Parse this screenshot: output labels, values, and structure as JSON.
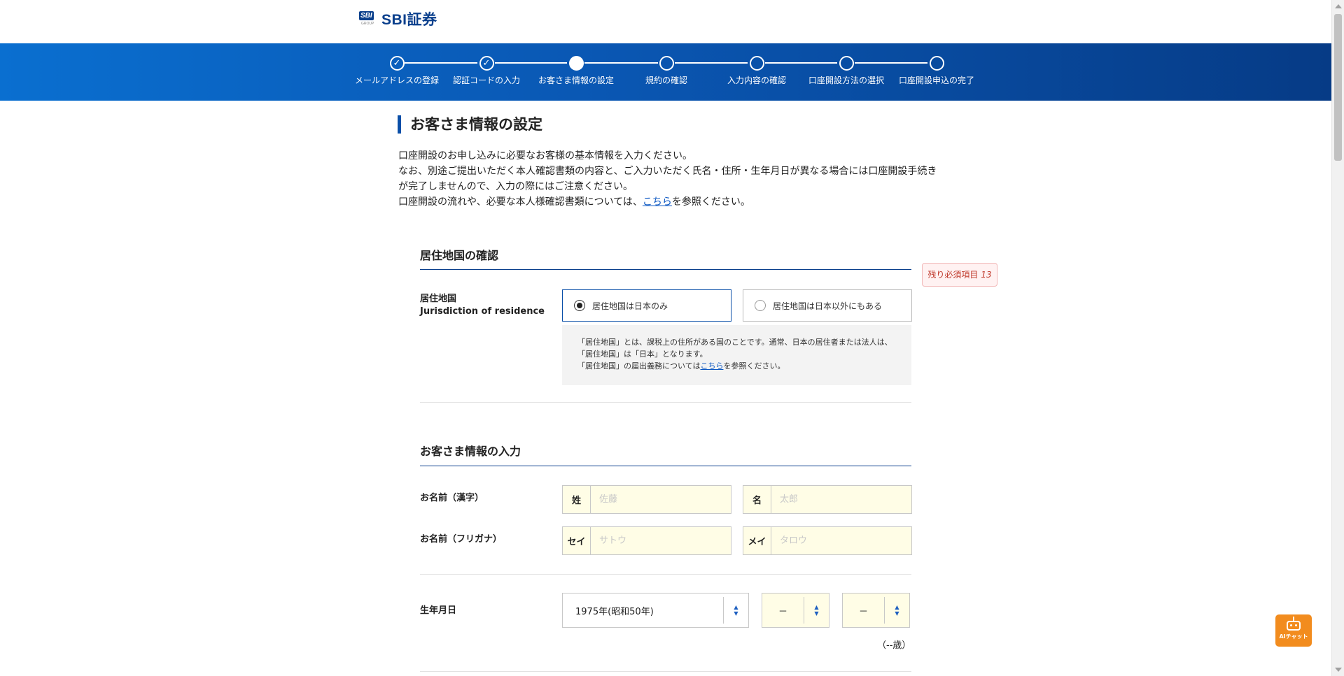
{
  "header": {
    "logo_badge": "SBI",
    "logo_group": "GROUP",
    "logo_text": "SBI証券"
  },
  "steps": [
    {
      "label": "メールアドレスの登録",
      "state": "done"
    },
    {
      "label": "認証コードの入力",
      "state": "done"
    },
    {
      "label": "お客さま情報の設定",
      "state": "current"
    },
    {
      "label": "規約の確認",
      "state": "todo"
    },
    {
      "label": "入力内容の確認",
      "state": "todo"
    },
    {
      "label": "口座開設方法の選択",
      "state": "todo"
    },
    {
      "label": "口座開設申込の完了",
      "state": "todo"
    }
  ],
  "page": {
    "title": "お客さま情報の設定",
    "intro_line1": "口座開設のお申し込みに必要なお客様の基本情報を入力ください。",
    "intro_line2": "なお、別途ご提出いただく本人確認書類の内容と、ご入力いただく氏名・住所・生年月日が異なる場合には口座開設手続きが完了しませんので、入力の際にはご注意ください。",
    "intro_line3_pre": "口座開設の流れや、必要な本人様確認書類については、",
    "intro_line3_link": "こちら",
    "intro_line3_post": "を参照ください。"
  },
  "residence": {
    "section_title": "居住地国の確認",
    "remaining_label": "残り必須項目",
    "remaining_count": "13",
    "label_ja": "居住地国",
    "label_en": "Jurisdiction of residence",
    "option_japan": "居住地国は日本のみ",
    "option_other": "居住地国は日本以外にもある",
    "note_line1": "「居住地国」とは、課税上の住所がある国のことです。通常、日本の居住者または法人は、",
    "note_line2": "「居住地国」は「日本」となります。",
    "note_line3_pre": "「居住地国」の届出義務については",
    "note_line3_link": "こちら",
    "note_line3_post": "を参照ください。"
  },
  "customer": {
    "section_title": "お客さま情報の入力",
    "name_kanji_label": "お名前（漢字）",
    "sei_prefix": "姓",
    "sei_placeholder": "佐藤",
    "mei_prefix": "名",
    "mei_placeholder": "太郎",
    "name_kana_label": "お名前（フリガナ）",
    "sei_kana_prefix": "セイ",
    "sei_kana_placeholder": "サトウ",
    "mei_kana_prefix": "メイ",
    "mei_kana_placeholder": "タロウ",
    "birth_label": "生年月日",
    "birth_year": "1975年(昭和50年)",
    "birth_month": "－",
    "birth_day": "－",
    "age": "（--歳）"
  },
  "ai_chat": {
    "label": "AIチャット"
  },
  "colors": {
    "brand": "#0a3f8c",
    "stepbar_start": "#0a6fd0",
    "stepbar_end": "#063b86",
    "input_bg": "#fffde6",
    "badge_text": "#c0392b",
    "ai_chat_bg": "#f28c1e"
  }
}
